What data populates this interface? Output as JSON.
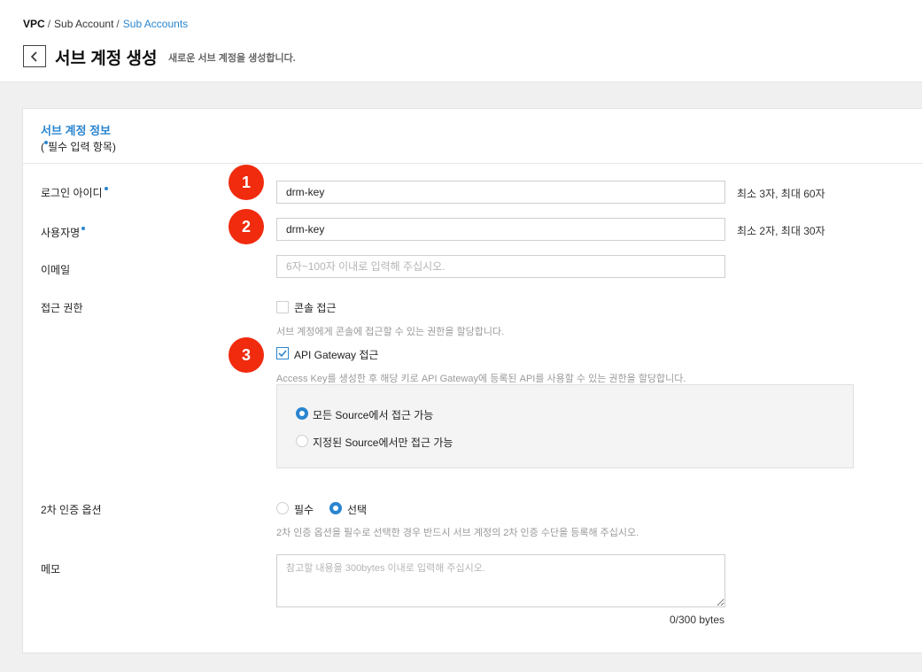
{
  "breadcrumb": {
    "root": "VPC",
    "sep": "/",
    "level1": "Sub Account",
    "level2": "Sub Accounts"
  },
  "header": {
    "title": "서브 계정 생성",
    "description": "새로운 서브 계정을 생성합니다."
  },
  "section": {
    "title": "서브 계정 정보",
    "required_note_open": "(",
    "required_note_text": "필수 입력 항목)"
  },
  "fields": {
    "login_id": {
      "label": "로그인 아이디",
      "value": "drm-key",
      "hint": "최소 3자, 최대 60자",
      "badge": "1"
    },
    "username": {
      "label": "사용자명",
      "value": "drm-key",
      "hint": "최소 2자, 최대 30자",
      "badge": "2"
    },
    "email": {
      "label": "이메일",
      "value": "",
      "placeholder": "6자~100자 이내로 입력해 주십시오."
    }
  },
  "access": {
    "label": "접근 권한",
    "console": {
      "label": "콘솔 접근",
      "checked": false,
      "help": "서브 계정에게 콘솔에 접근할 수 있는 권한을 할당합니다."
    },
    "api_gateway": {
      "label": "API Gateway 접근",
      "checked": true,
      "badge": "3",
      "help": "Access Key를 생성한 후 해당 키로 API Gateway에 등록된 API를 사용할 수 있는 권한을 할당합니다."
    },
    "source_options": [
      {
        "label": "모든 Source에서 접근 가능",
        "selected": true
      },
      {
        "label": "지정된 Source에서만 접근 가능",
        "selected": false
      }
    ]
  },
  "two_factor": {
    "label": "2차 인증 옵션",
    "options": [
      {
        "label": "필수",
        "selected": false
      },
      {
        "label": "선택",
        "selected": true
      }
    ],
    "help": "2차 인증 옵션을 필수로 선택한 경우 반드시 서브 계정의 2차 인증 수단을 등록해 주십시오."
  },
  "memo": {
    "label": "메모",
    "placeholder": "참고할 내용을 300bytes 이내로 입력해 주십시오.",
    "counter": "0/300 bytes"
  },
  "colors": {
    "accent": "#2a85d0",
    "badge": "#f02b0e",
    "background": "#f0f0f0"
  },
  "icons": {
    "back": "chevron-left-icon",
    "check": "checkmark-icon"
  }
}
